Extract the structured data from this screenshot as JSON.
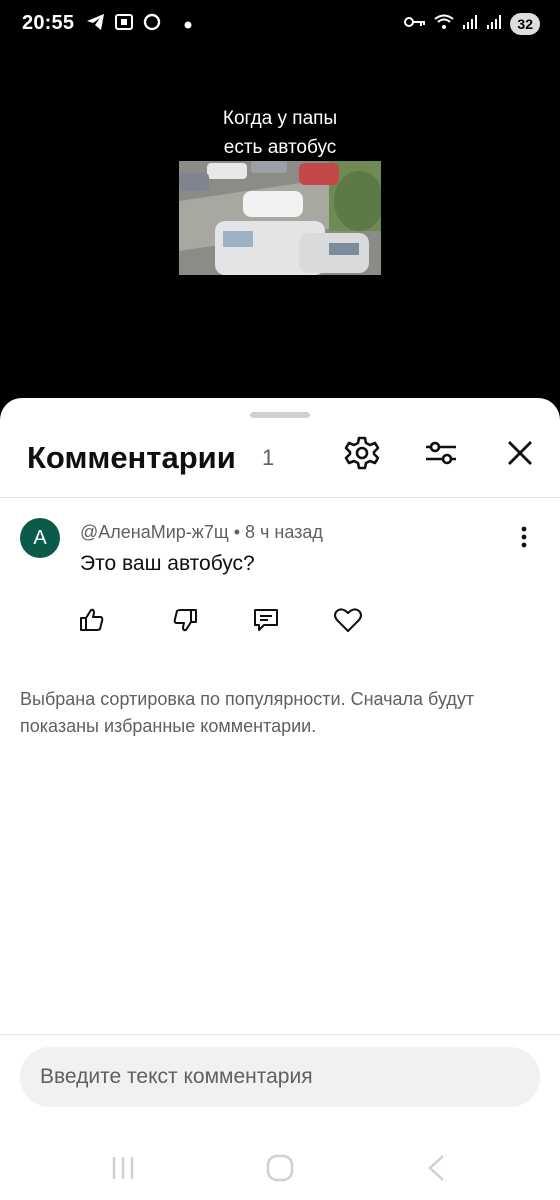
{
  "status_bar": {
    "time": "20:55",
    "battery": "32",
    "left_icons": [
      "telegram-icon",
      "screenshot-icon",
      "chat-bubble-icon",
      "dot-icon"
    ],
    "right_icons": [
      "key-icon",
      "wifi-icon",
      "signal-icon",
      "signal-icon",
      "battery-icon"
    ]
  },
  "video": {
    "caption_line1": "Когда у папы",
    "caption_line2": "есть автобус"
  },
  "comments_sheet": {
    "title": "Комментарии",
    "count": "1",
    "header_icons": [
      "settings-gear-icon",
      "filter-sliders-icon",
      "close-icon"
    ],
    "comment": {
      "avatar_letter": "А",
      "avatar_color": "#0b5a4a",
      "author": "@АленаМир-ж7щ",
      "separator": "•",
      "time": "8 ч назад",
      "text": "Это ваш автобус?",
      "actions": [
        "like-icon",
        "dislike-icon",
        "reply-icon",
        "heart-icon"
      ]
    },
    "sort_notice": "Выбрана сортировка по популярности. Сначала будут показаны избранные комментарии.",
    "input_placeholder": "Введите текст комментария"
  },
  "nav_bar": {
    "buttons": [
      "recent-apps-icon",
      "home-icon",
      "back-icon"
    ]
  }
}
